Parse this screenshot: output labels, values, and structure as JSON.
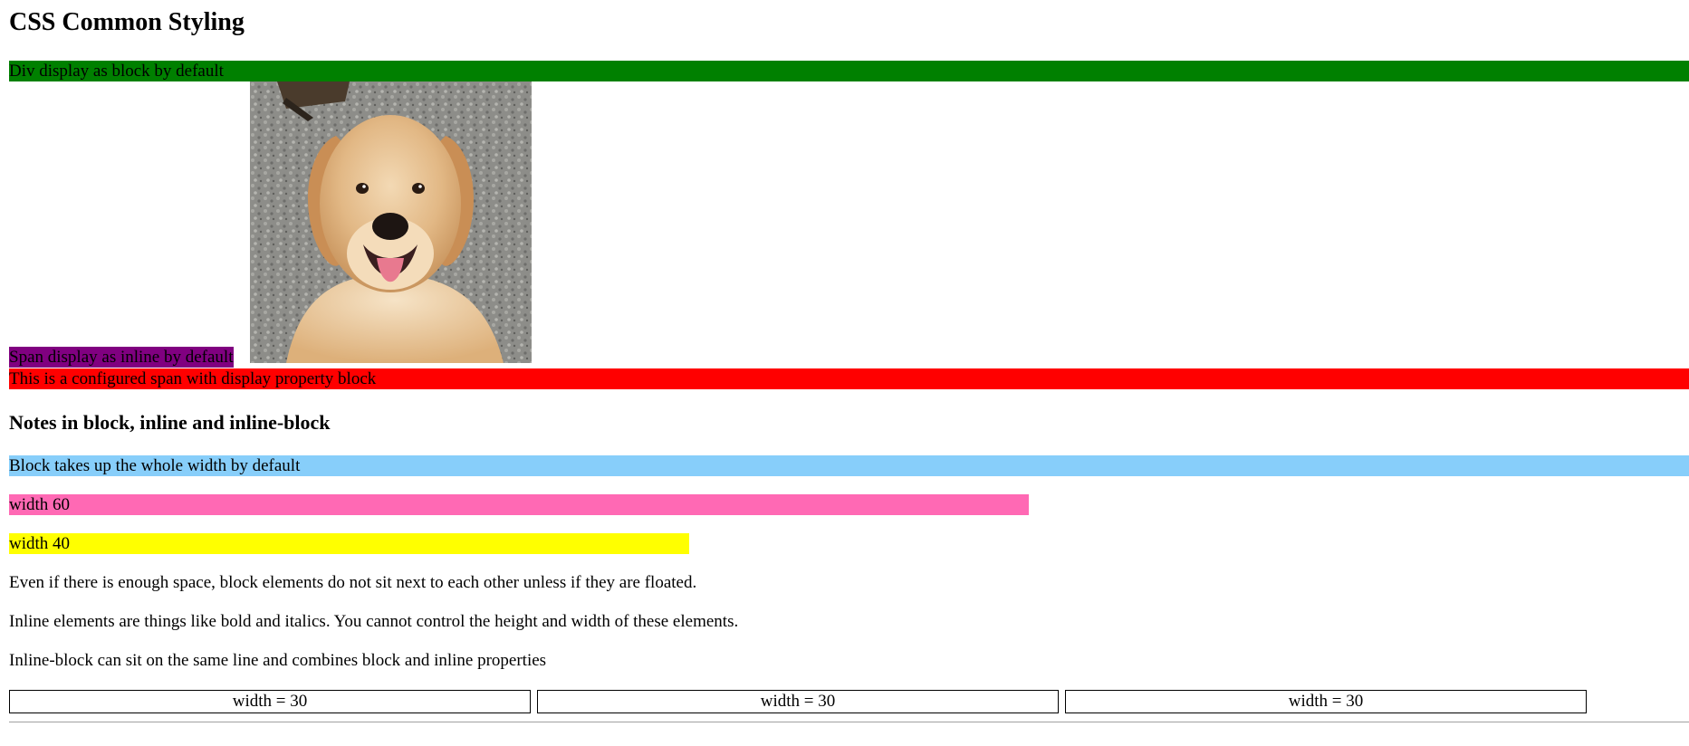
{
  "page": {
    "title": "CSS Common Styling"
  },
  "section_display": {
    "div_text": "Div display as block by default",
    "span_text": "Span display as inline by default",
    "block_span_text": "This is a configured span with display property block"
  },
  "image": {
    "subject": "golden retriever dog photo"
  },
  "section_notes": {
    "heading": "Notes in block, inline and inline-block",
    "bars": [
      {
        "label": "Block takes up the whole width by default",
        "width_percent": 100
      },
      {
        "label": "width 60",
        "width_percent": 60
      },
      {
        "label": "width 40",
        "width_percent": 40
      }
    ],
    "paragraphs": [
      "Even if there is enough space, block elements do not sit next to each other unless if they are floated.",
      "Inline elements are things like bold and italics. You cannot control the height and width of these elements.",
      "Inline-block can sit on the same line and combines block and inline properties"
    ],
    "inline_blocks": [
      {
        "label": "width = 30",
        "width_percent": 30
      },
      {
        "label": "width = 30",
        "width_percent": 30
      },
      {
        "label": "width = 30",
        "width_percent": 30
      }
    ]
  },
  "colors": {
    "div_bg": "#008000",
    "span_bg": "#800080",
    "block_span_bg": "#ff0000",
    "blue_bar": "#87cefa",
    "pink_bar": "#ff69b4",
    "yellow_bar": "#ffff00"
  }
}
